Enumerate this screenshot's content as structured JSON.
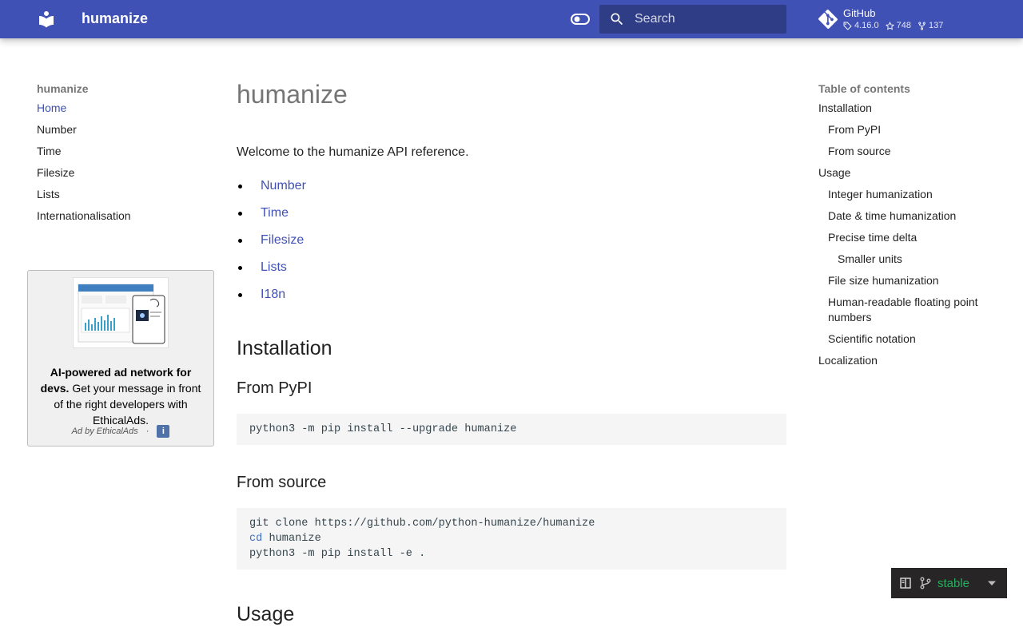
{
  "header": {
    "site_title": "humanize",
    "search_placeholder": "Search",
    "repo": {
      "name": "GitHub",
      "version": "4.16.0",
      "stars": "748",
      "forks": "137"
    }
  },
  "nav": {
    "title": "humanize",
    "items": [
      {
        "label": "Home"
      },
      {
        "label": "Number"
      },
      {
        "label": "Time"
      },
      {
        "label": "Filesize"
      },
      {
        "label": "Lists"
      },
      {
        "label": "Internationalisation"
      }
    ]
  },
  "ad": {
    "headline": "AI-powered ad network for devs.",
    "body": "Get your message in front of the right developers with EthicalAds.",
    "footer": "Ad by EthicalAds",
    "separator": "·",
    "info": "i"
  },
  "main": {
    "title": "humanize",
    "intro": "Welcome to the humanize API reference.",
    "links": [
      {
        "label": "Number"
      },
      {
        "label": "Time"
      },
      {
        "label": "Filesize"
      },
      {
        "label": "Lists"
      },
      {
        "label": "I18n"
      }
    ],
    "installation": {
      "heading": "Installation",
      "pypi_heading": "From PyPI",
      "pypi_code": "python3 -m pip install --upgrade humanize",
      "source_heading": "From source",
      "source_line1": "git clone https://github.com/python-humanize/humanize",
      "source_line2_kw": "cd",
      "source_line2_rest": " humanize",
      "source_line3": "python3 -m pip install -e ."
    },
    "usage_heading": "Usage"
  },
  "toc": {
    "title": "Table of contents",
    "items": [
      {
        "label": "Installation"
      },
      {
        "label": "From PyPI"
      },
      {
        "label": "From source"
      },
      {
        "label": "Usage"
      },
      {
        "label": "Integer humanization"
      },
      {
        "label": "Date & time humanization"
      },
      {
        "label": "Precise time delta"
      },
      {
        "label": "Smaller units"
      },
      {
        "label": "File size humanization"
      },
      {
        "label": "Human-readable floating point numbers"
      },
      {
        "label": "Scientific notation"
      },
      {
        "label": "Localization"
      }
    ]
  },
  "version_badge": {
    "label": "stable"
  },
  "colors": {
    "primary": "#4051b5",
    "link": "#4051b5",
    "badge_text": "#27ae60"
  }
}
